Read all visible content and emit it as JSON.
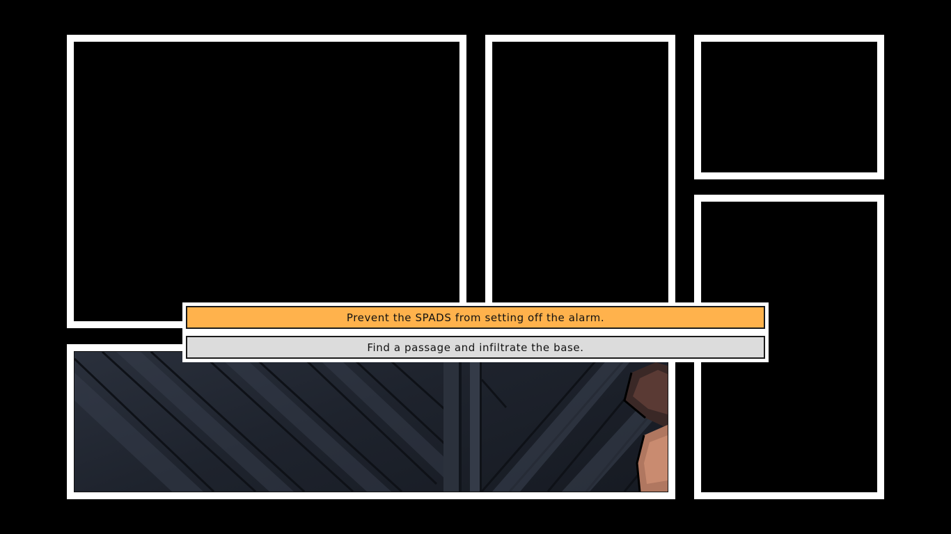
{
  "hud": {
    "objectives": [
      {
        "text": "Prevent the SPADS from setting off the alarm.",
        "state": "active",
        "color": "#ffb24c"
      },
      {
        "text": "Find a passage and infiltrate the base.",
        "state": "pending",
        "color": "#dcdcdc"
      }
    ]
  },
  "scene": {
    "description_icon": "comic-panel-scene"
  }
}
